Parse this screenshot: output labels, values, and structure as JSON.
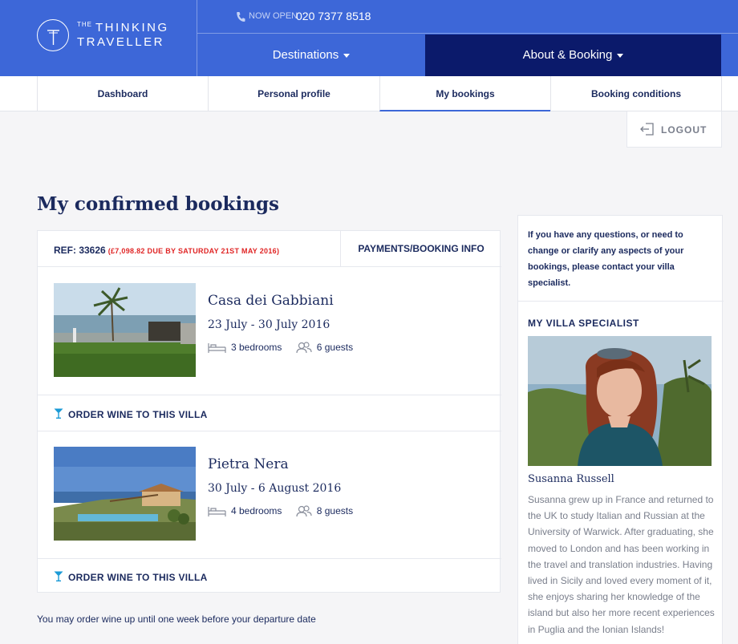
{
  "brand": {
    "logo_line1_small": "THE",
    "logo_line1": "THINKING",
    "logo_line2": "TRAVELLER"
  },
  "header": {
    "now_open": "NOW OPEN",
    "phone": "020 7377 8518",
    "nav": [
      {
        "label": "Destinations"
      },
      {
        "label": "About & Booking"
      }
    ]
  },
  "tabs": [
    {
      "label": "Dashboard"
    },
    {
      "label": "Personal profile"
    },
    {
      "label": "My bookings",
      "active": true
    },
    {
      "label": "Booking conditions"
    }
  ],
  "logout_label": "LOGOUT",
  "page_title": "My confirmed bookings",
  "booking": {
    "ref": "REF: 33626",
    "due": "(£7,098.82 DUE BY SATURDAY 21ST MAY 2016)",
    "payments_link": "PAYMENTS/BOOKING INFO",
    "villas": [
      {
        "name": "Casa dei Gabbiani",
        "dates": "23 July - 30 July 2016",
        "bedrooms": "3 bedrooms",
        "guests": "6 guests",
        "wine_label": "ORDER WINE TO THIS VILLA"
      },
      {
        "name": "Pietra Nera",
        "dates": "30 July - 6 August 2016",
        "bedrooms": "4 bedrooms",
        "guests": "8 guests",
        "wine_label": "ORDER WINE TO THIS VILLA"
      }
    ]
  },
  "note": "You may order wine up until one week before your departure date",
  "sidebar": {
    "question": "If you have any questions, or need to change or clarify any aspects of your bookings, please contact your villa specialist.",
    "heading": "MY VILLA SPECIALIST",
    "specialist_name": "Susanna Russell",
    "bio": "Susanna grew up in France and returned to the UK to study Italian and Russian at the University of Warwick. After graduating, she moved to London and has been working in the travel and translation industries. Having lived in Sicily and loved every moment of it, she enjoys sharing her knowledge of the island but also her more recent experiences in Puglia and the Ionian Islands!"
  },
  "colors": {
    "brand_blue": "#3d67d8",
    "navy": "#0b1a6b",
    "text": "#1b2a5e",
    "due_red": "#e02525",
    "wine_icon": "#1a9ad6"
  },
  "icons": [
    "phone-icon",
    "caret-down-icon",
    "logout-icon",
    "bed-icon",
    "guests-icon",
    "cocktail-glass-icon"
  ]
}
